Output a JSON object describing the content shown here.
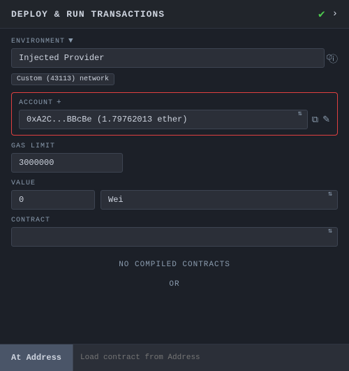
{
  "header": {
    "title": "DEPLOY & RUN TRANSACTIONS",
    "check_icon": "✔",
    "chevron_icon": "›"
  },
  "environment": {
    "label": "ENVIRONMENT",
    "filter_icon": "▼",
    "selected": "Injected Provider",
    "info_icon": "ⓘ",
    "network_badge": "Custom (43113) network"
  },
  "account": {
    "label": "ACCOUNT",
    "plus_icon": "+",
    "selected": "0xA2C...BBcBe (1.79762013 ether)",
    "copy_icon": "⧉",
    "edit_icon": "✎"
  },
  "gas_limit": {
    "label": "GAS LIMIT",
    "value": "3000000"
  },
  "value": {
    "label": "VALUE",
    "amount": "0",
    "unit": "Wei"
  },
  "contract": {
    "label": "CONTRACT",
    "selected": ""
  },
  "no_contracts": {
    "message": "NO COMPILED CONTRACTS"
  },
  "or_divider": "OR",
  "bottom": {
    "at_address_label": "At Address",
    "load_placeholder": "Load contract from Address"
  }
}
